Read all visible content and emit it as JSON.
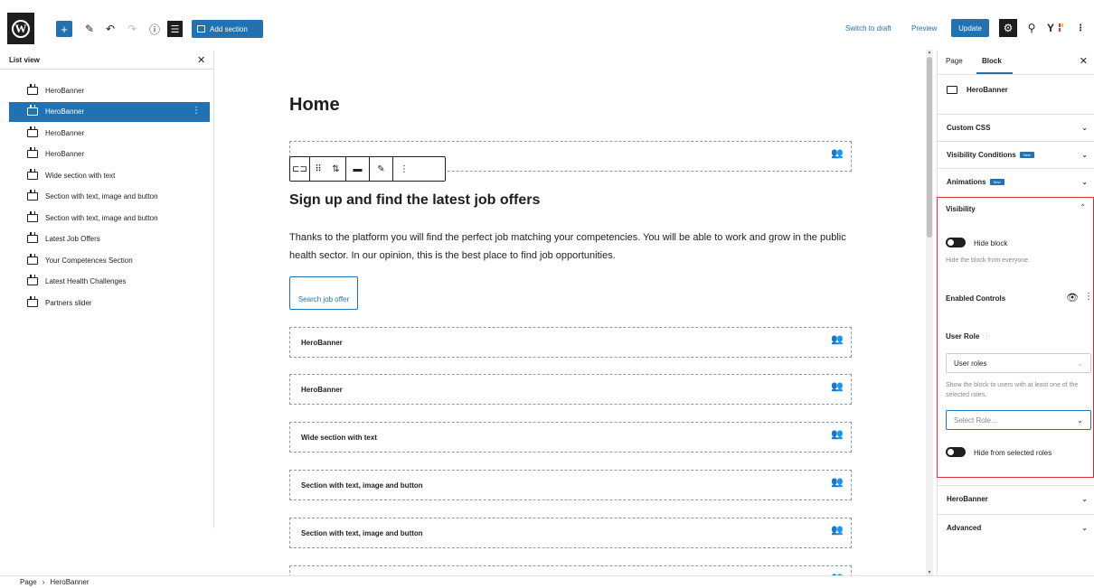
{
  "topbar": {
    "logo_letter": "W",
    "add_section_label": "Add section",
    "switch_to_draft_label": "Switch to draft",
    "preview_label": "Preview",
    "update_label": "Update"
  },
  "list_view": {
    "title": "List view",
    "items": [
      {
        "label": "HeroBanner",
        "selected": false
      },
      {
        "label": "HeroBanner",
        "selected": true
      },
      {
        "label": "HeroBanner",
        "selected": false
      },
      {
        "label": "HeroBanner",
        "selected": false
      },
      {
        "label": "Wide section with text",
        "selected": false
      },
      {
        "label": "Section with text, image and button",
        "selected": false
      },
      {
        "label": "Section with text, image and button",
        "selected": false
      },
      {
        "label": "Latest Job Offers",
        "selected": false
      },
      {
        "label": "Your Competences Section",
        "selected": false
      },
      {
        "label": "Latest Health Challenges",
        "selected": false
      },
      {
        "label": "Partners slider",
        "selected": false
      }
    ]
  },
  "canvas": {
    "page_title": "Home",
    "heading": "Sign up and find the latest job offers",
    "paragraph": "Thanks to the platform you will find the perfect job matching your competencies. You will be able to work and grow in the public health sector. In our opinion, this is the best place to find job opportunities.",
    "search_button_label": "Search job offer",
    "blocks": [
      {
        "label": "HeroBanner"
      },
      {
        "label": "HeroBanner"
      },
      {
        "label": "Wide section with text"
      },
      {
        "label": "Section with text, image and button"
      },
      {
        "label": "Section with text, image and button"
      }
    ]
  },
  "sidebar": {
    "tab_page": "Page",
    "tab_block": "Block",
    "block_name": "HeroBanner",
    "custom_css_label": "Custom CSS",
    "visibility_conditions_label": "Visibility Conditions",
    "animations_label": "Animations",
    "new_badge": "New",
    "visibility": {
      "title": "Visibility",
      "hide_block_label": "Hide block",
      "hide_block_help": "Hide the block from everyone.",
      "enabled_controls_label": "Enabled Controls",
      "user_role_label": "User Role",
      "user_roles_select_value": "User roles",
      "user_role_help": "Show the block to users with at least one of the selected roles.",
      "select_role_placeholder": "Select Role...",
      "hide_from_selected_roles_label": "Hide from selected roles"
    },
    "herobanner_section_label": "HeroBanner",
    "advanced_label": "Advanced"
  },
  "footer": {
    "breadcrumb_page": "Page",
    "breadcrumb_separator": "›",
    "breadcrumb_current": "HeroBanner"
  },
  "colors": {
    "accent": "#2271b1",
    "highlight_border": "#d63638",
    "dark": "#1e1e1e"
  }
}
